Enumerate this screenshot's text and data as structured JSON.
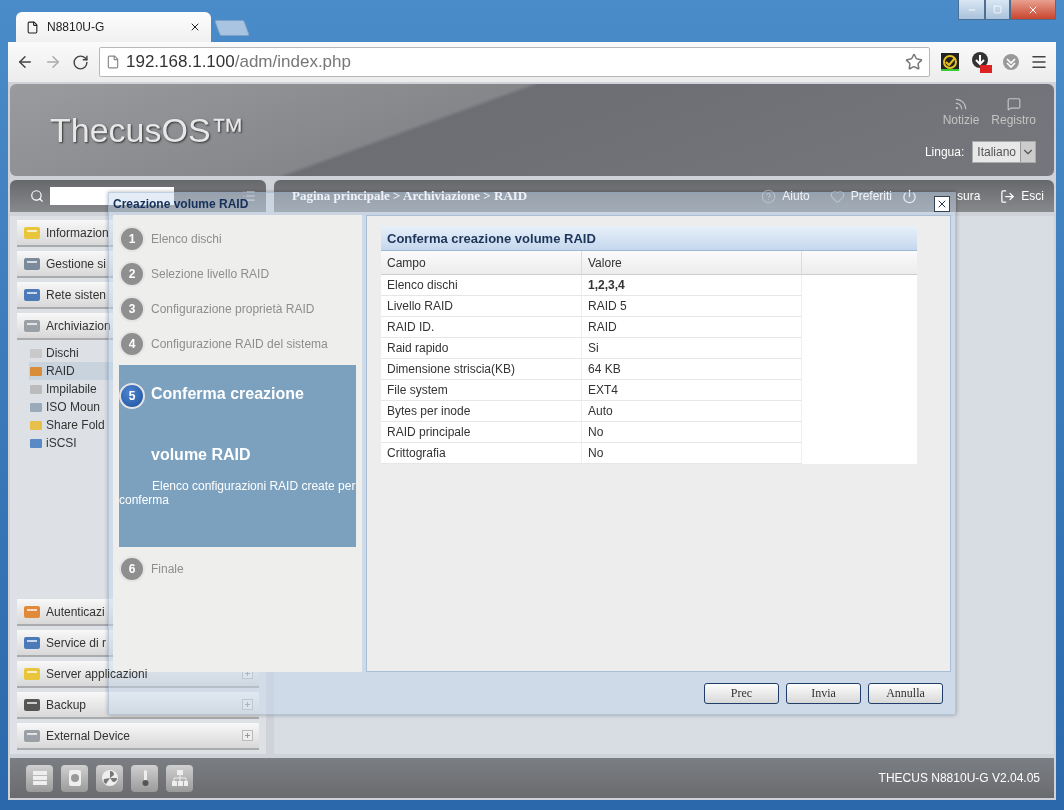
{
  "browser": {
    "tab_title": "N8810U-G",
    "url_host": "192.168.1.100",
    "url_path": "/adm/index.php"
  },
  "header": {
    "logo": "ThecusOS™",
    "actions": [
      {
        "label": "Notizie"
      },
      {
        "label": "Registro"
      }
    ],
    "language_label": "Lingua:",
    "language_value": "Italiano"
  },
  "breadcrumb": "Pagina principale > Archiviazione > RAID",
  "top_links": [
    {
      "label": "Aiuto"
    },
    {
      "label": "Preferiti"
    },
    {
      "label": "sura"
    },
    {
      "label": "Esci"
    }
  ],
  "sidebar": {
    "top_groups": [
      {
        "label": "Informazion"
      },
      {
        "label": "Gestione si"
      },
      {
        "label": "Rete sisten"
      },
      {
        "label": "Archiviazion",
        "children": [
          {
            "label": "Dischi",
            "selected": false
          },
          {
            "label": "RAID",
            "selected": true
          },
          {
            "label": "Impilabile",
            "selected": false
          },
          {
            "label": "ISO Moun",
            "selected": false
          },
          {
            "label": "Share Fold",
            "selected": false
          },
          {
            "label": "iSCSI",
            "selected": false
          }
        ]
      }
    ],
    "bottom_groups": [
      {
        "label": "Autenticazi"
      },
      {
        "label": "Service di r"
      },
      {
        "label": "Server applicazioni",
        "expand_marker": true
      },
      {
        "label": "Backup",
        "expand_marker": true
      },
      {
        "label": "External Device",
        "expand_marker": true
      }
    ]
  },
  "footer": {
    "version": "THECUS N8810U-G V2.04.05"
  },
  "dialog": {
    "title": "Creazione volume RAID",
    "steps": [
      {
        "number": "1",
        "label": "Elenco dischi",
        "selected": false
      },
      {
        "number": "2",
        "label": "Selezione livello RAID",
        "selected": false
      },
      {
        "number": "3",
        "label": "Configurazione proprietà RAID",
        "selected": false
      },
      {
        "number": "4",
        "label": "Configurazione RAID del sistema",
        "selected": false
      },
      {
        "number": "5",
        "label": "Conferma creazione volume RAID",
        "selected": true,
        "description": "Elenco configurazioni RAID create per conferma"
      },
      {
        "number": "6",
        "label": "Finale",
        "selected": false
      }
    ],
    "panel_title": "Conferma creazione volume RAID",
    "columns": [
      "Campo",
      "Valore"
    ],
    "rows": [
      {
        "field": "Elenco dischi",
        "value": "1,2,3,4",
        "emphasis": true
      },
      {
        "field": "Livello RAID",
        "value": "RAID 5",
        "emphasis": false
      },
      {
        "field": "RAID ID.",
        "value": "RAID",
        "emphasis": false
      },
      {
        "field": "Raid rapido",
        "value": "Si",
        "emphasis": false
      },
      {
        "field": "Dimensione striscia(KB)",
        "value": "64 KB",
        "emphasis": false
      },
      {
        "field": "File system",
        "value": "EXT4",
        "emphasis": false
      },
      {
        "field": "Bytes per inode",
        "value": "Auto",
        "emphasis": false
      },
      {
        "field": "RAID principale",
        "value": "No",
        "emphasis": false
      },
      {
        "field": "Crittografia",
        "value": "No",
        "emphasis": false
      }
    ],
    "buttons": [
      "Prec",
      "Invia",
      "Annulla"
    ]
  }
}
